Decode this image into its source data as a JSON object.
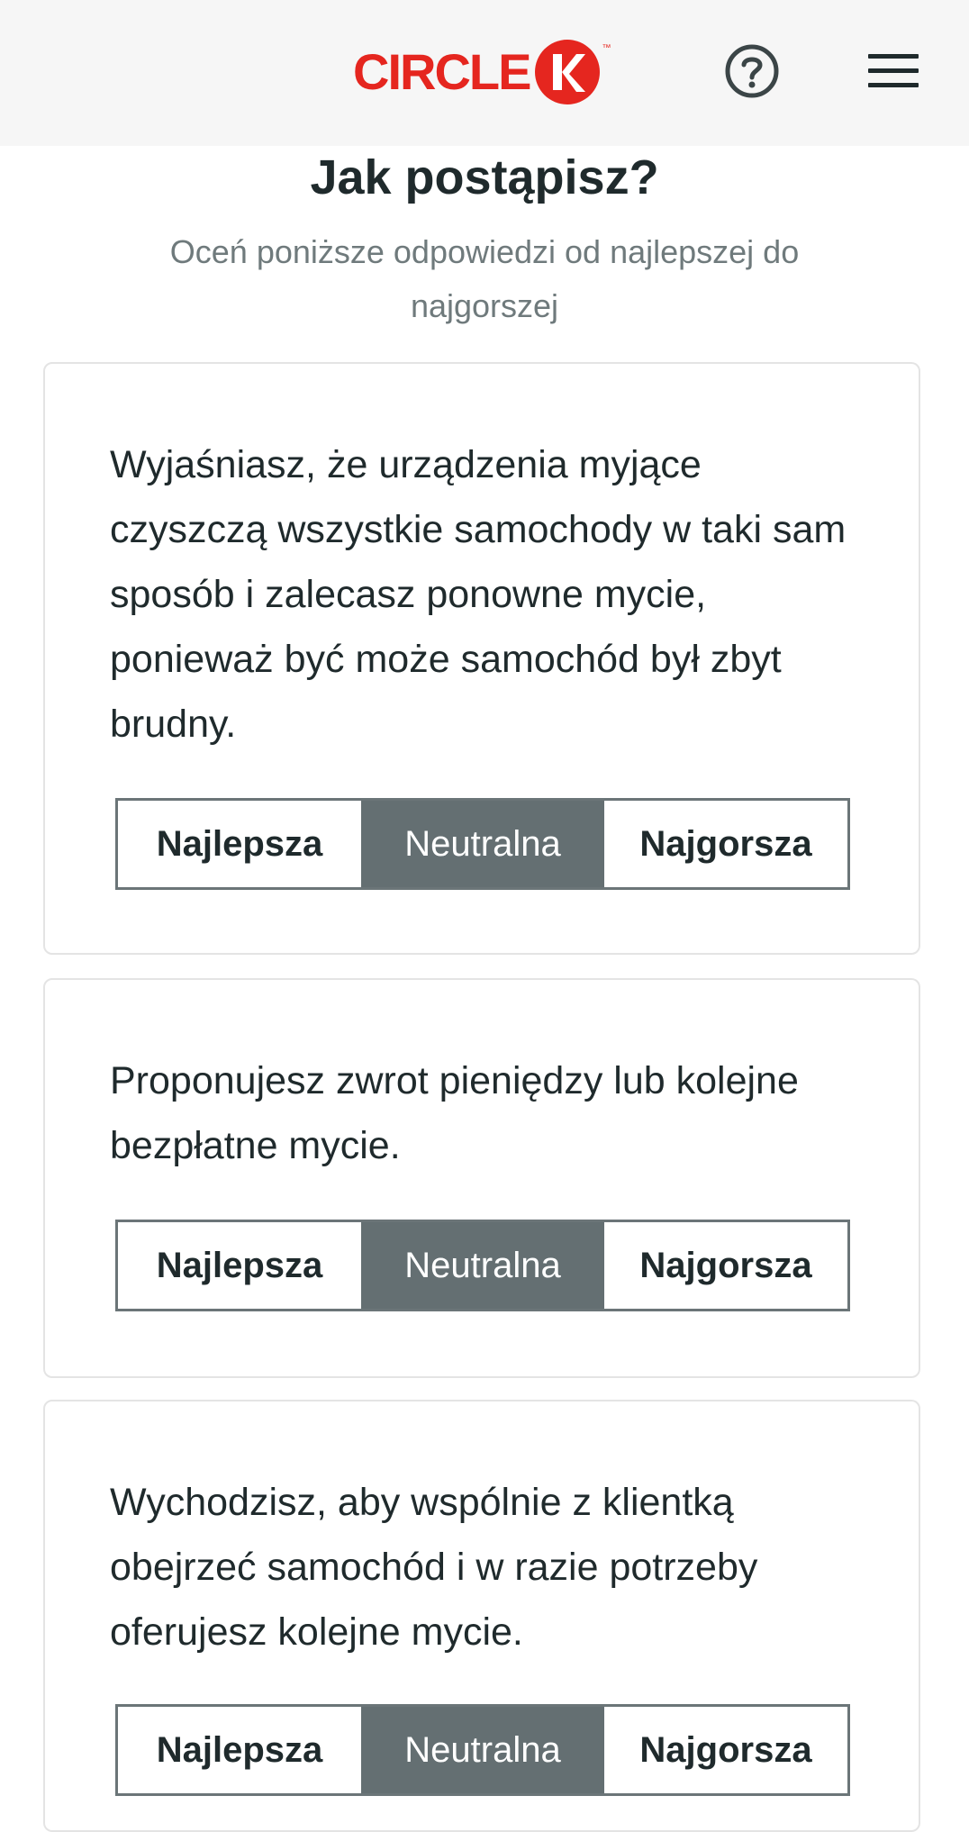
{
  "header": {
    "logo_text": "CIRCLE",
    "logo_mark": "K",
    "logo_tm": "™",
    "help_icon": "question-circle-icon",
    "menu_icon": "hamburger-menu-icon",
    "brand_color": "#e5261f"
  },
  "page": {
    "title": "Jak postąpisz?",
    "subtitle": "Oceń poniższe odpowiedzi od najlepszej do najgorszej"
  },
  "cards": [
    {
      "text": "Wyjaśniasz, że urządzenia myjące czyszczą wszystkie samochody w taki sam sposób i zalecasz ponowne mycie, ponieważ być może samochód był zbyt brudny.",
      "options": [
        "Najlepsza",
        "Neutralna",
        "Najgorsza"
      ],
      "selected": "Neutralna"
    },
    {
      "text": "Proponujesz zwrot pieniędzy lub kolejne bezpłatne mycie.",
      "options": [
        "Najlepsza",
        "Neutralna",
        "Najgorsza"
      ],
      "selected": "Neutralna"
    },
    {
      "text": "Wychodzisz, aby wspólnie z klientką obejrzeć samochód i w razie potrzeby oferujesz kolejne mycie.",
      "options": [
        "Najlepsza",
        "Neutralna",
        "Najgorsza"
      ],
      "selected": "Neutralna"
    }
  ],
  "colors": {
    "selected_segment": "#646f72",
    "segment_border": "#6b7578",
    "text": "#1f2a2c",
    "muted_text": "#6f7a7c"
  }
}
